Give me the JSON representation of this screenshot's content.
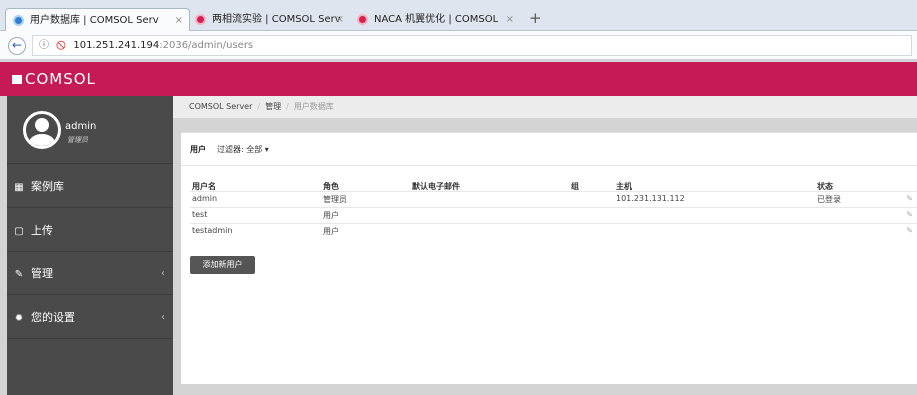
{
  "tabs": [
    {
      "title": "用户数据库 | COMSOL Serv",
      "favicon_color": "#2f80d1"
    },
    {
      "title": "两相流实验 | COMSOL Serv",
      "favicon_color": "#d6204f"
    },
    {
      "title": "NACA 机翼优化 | COMSOL",
      "favicon_color": "#d6204f"
    }
  ],
  "tab_close": "×",
  "new_tab": "+",
  "address": {
    "host": "101.251.241.194",
    "path": ":2036/admin/users",
    "info_icon": "ⓘ",
    "insecure_icon": "🚫"
  },
  "brand": {
    "name": "COMSOL",
    "color": "#c51a55"
  },
  "user": {
    "name": "admin",
    "role": "管理员"
  },
  "nav": [
    {
      "icon": "grid-icon",
      "glyph": "▦",
      "label": "案例库"
    },
    {
      "icon": "upload-icon",
      "glyph": "▢",
      "label": "上传"
    },
    {
      "icon": "wrench-icon",
      "glyph": "✎",
      "label": "管理",
      "chevron": "‹"
    },
    {
      "icon": "gear-icon",
      "glyph": "✹",
      "label": "您的设置",
      "chevron": "‹"
    }
  ],
  "breadcrumb": {
    "root": "COMSOL Server",
    "section": "管理",
    "current": "用户数据库",
    "sep": "/"
  },
  "panel": {
    "title": "用户",
    "filter": "过滤器: 全部 ▾"
  },
  "table": {
    "columns": [
      "用户名",
      "角色",
      "默认电子邮件",
      "组",
      "主机",
      "状态"
    ],
    "rows": [
      [
        "admin",
        "管理员",
        "",
        "",
        "101.231.131.112",
        "已登录"
      ],
      [
        "test",
        "用户",
        "",
        "",
        "",
        ""
      ],
      [
        "testadmin",
        "用户",
        "",
        "",
        "",
        ""
      ]
    ],
    "edit_glyph": "✎"
  },
  "add_button": "添加新用户"
}
